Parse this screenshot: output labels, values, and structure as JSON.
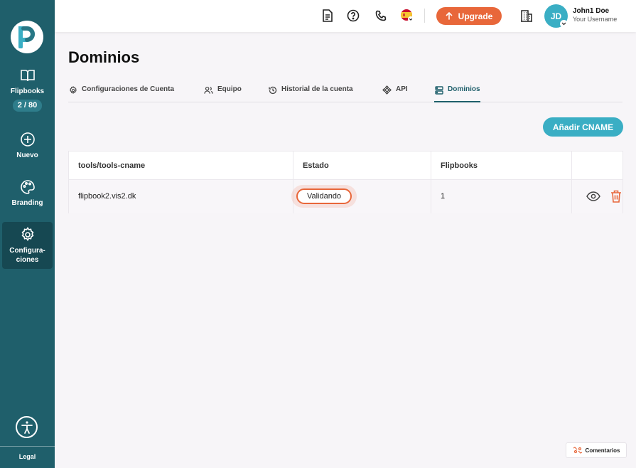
{
  "sidebar": {
    "logo_letter": "P",
    "items": [
      {
        "label": "Flipbooks",
        "icon": "book-icon",
        "count": "2 / 80"
      },
      {
        "label": "Nuevo",
        "icon": "plus-circle-icon"
      },
      {
        "label": "Branding",
        "icon": "palette-icon"
      },
      {
        "label": "Configura-\nciones",
        "icon": "gear-icon",
        "active": true
      }
    ],
    "legal": "Legal"
  },
  "topbar": {
    "upgrade_label": "Upgrade",
    "avatar_initials": "JD",
    "user_name": "John1 Doe",
    "user_subtitle": "Your Username",
    "icons": [
      "document-icon",
      "help-icon",
      "phone-icon",
      "flag-es-icon",
      "building-icon"
    ]
  },
  "page": {
    "title": "Dominios",
    "tabs": [
      {
        "label": "Configuraciones de Cuenta",
        "icon": "gear-icon"
      },
      {
        "label": "Equipo",
        "icon": "users-icon"
      },
      {
        "label": "Historial de la cuenta",
        "icon": "history-icon"
      },
      {
        "label": "API",
        "icon": "api-icon"
      },
      {
        "label": "Dominios",
        "icon": "server-icon",
        "active": true
      }
    ],
    "add_button": "Añadir CNAME"
  },
  "table": {
    "columns": [
      "tools/tools-cname",
      "Estado",
      "Flipbooks"
    ],
    "rows": [
      {
        "domain": "flipbook2.vis2.dk",
        "status": "Validando",
        "flipbooks": "1"
      }
    ]
  },
  "feedback": {
    "label": "Comentarios"
  },
  "colors": {
    "sidebar": "#1f5f6b",
    "accent_orange": "#e8673a",
    "accent_teal": "#3aaec4"
  }
}
